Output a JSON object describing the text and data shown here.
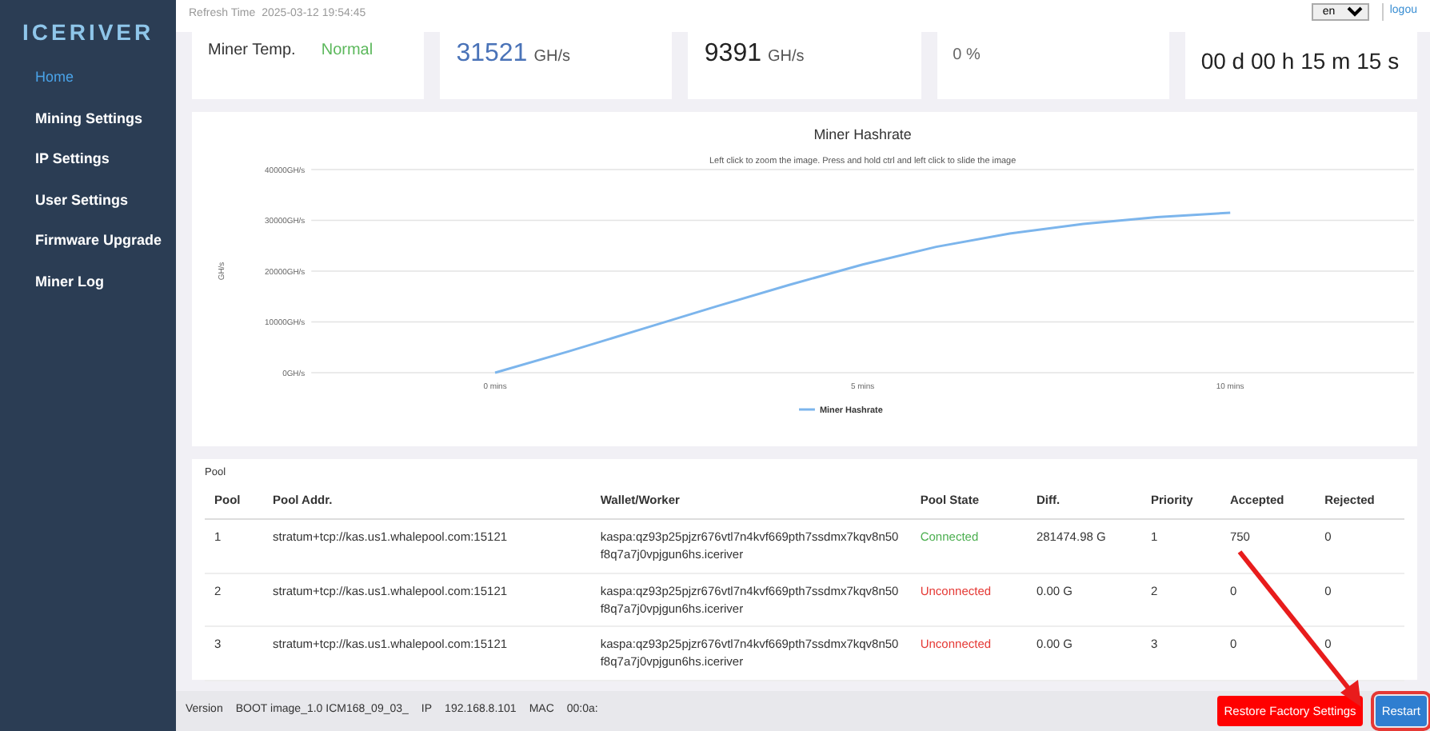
{
  "sidebar": {
    "logo": "ICERIVER",
    "items": [
      {
        "label": "Home",
        "selected": true
      },
      {
        "label": "Mining Settings",
        "selected": false
      },
      {
        "label": "IP Settings",
        "selected": false
      },
      {
        "label": "User Settings",
        "selected": false
      },
      {
        "label": "Firmware Upgrade",
        "selected": false
      },
      {
        "label": "Miner Log",
        "selected": false
      }
    ]
  },
  "header": {
    "refresh_label": "Refresh Time",
    "refresh_time": "2025-03-12 19:54:45",
    "language": "en",
    "logout": "logou"
  },
  "status_cards": [
    {
      "kind": "status",
      "rows": [
        {
          "label": "Miner Temp.",
          "value": "Normal"
        }
      ]
    },
    {
      "kind": "value",
      "value": "31521",
      "unit": "GH/s",
      "accent": true
    },
    {
      "kind": "value",
      "value": "9391",
      "unit": "GH/s",
      "accent": false
    },
    {
      "kind": "small",
      "value": "0 %"
    },
    {
      "kind": "value",
      "value": "00 d 00 h 15 m 15 s",
      "accent": false
    }
  ],
  "chart": {
    "chart_data": {
      "type": "line",
      "title": "Miner Hashrate",
      "subtitle": "Left click to zoom the image. Press and hold ctrl and left click to slide the image",
      "ylabel": "GH/s",
      "x": [
        0,
        1,
        2,
        3,
        4,
        5,
        6,
        7,
        8,
        9,
        10
      ],
      "series": [
        {
          "name": "Miner Hashrate",
          "color": "#7cb5ec",
          "values": [
            0,
            4200,
            8600,
            13000,
            17300,
            21300,
            24800,
            27400,
            29300,
            30600,
            31500
          ]
        }
      ],
      "grid": true,
      "xlim": [
        -2.5,
        12.5
      ],
      "ylim": [
        0,
        40000
      ],
      "xticks": [
        {
          "value": 0,
          "label": "0 mins"
        },
        {
          "value": 5,
          "label": "5 mins"
        },
        {
          "value": 10,
          "label": "10 mins"
        }
      ],
      "yticks": [
        {
          "value": 0,
          "label": "0GH/s"
        },
        {
          "value": 10000,
          "label": "10000GH/s"
        },
        {
          "value": 20000,
          "label": "20000GH/s"
        },
        {
          "value": 30000,
          "label": "30000GH/s"
        },
        {
          "value": 40000,
          "label": "40000GH/s"
        }
      ]
    }
  },
  "pool": {
    "title": "Pool",
    "columns": [
      "Pool",
      "Pool Addr.",
      "Wallet/Worker",
      "Pool State",
      "Diff.",
      "Priority",
      "Accepted",
      "Rejected"
    ],
    "rows": [
      {
        "pool": "1",
        "addr": "stratum+tcp://kas.us1.whalepool.com:15121",
        "wallet": "kaspa:qz93p25pjzr676vtl7n4kvf669pth7ssdmx7kqv8n50f8q7a7j0vpjgun6hs.iceriver",
        "connected": true,
        "state": "Connected",
        "diff": "281474.98 G",
        "priority": "1",
        "accepted": "750",
        "rejected": "0"
      },
      {
        "pool": "2",
        "addr": "stratum+tcp://kas.us1.whalepool.com:15121",
        "wallet": "kaspa:qz93p25pjzr676vtl7n4kvf669pth7ssdmx7kqv8n50f8q7a7j0vpjgun6hs.iceriver",
        "connected": false,
        "state": "Unconnected",
        "diff": "0.00 G",
        "priority": "2",
        "accepted": "0",
        "rejected": "0"
      },
      {
        "pool": "3",
        "addr": "stratum+tcp://kas.us1.whalepool.com:15121",
        "wallet": "kaspa:qz93p25pjzr676vtl7n4kvf669pth7ssdmx7kqv8n50f8q7a7j0vpjgun6hs.iceriver",
        "connected": false,
        "state": "Unconnected",
        "diff": "0.00 G",
        "priority": "3",
        "accepted": "0",
        "rejected": "0"
      }
    ]
  },
  "footer": {
    "fields": [
      {
        "label": "Version",
        "value": "BOOT image_1.0 ICM168_09_03_"
      },
      {
        "label": "IP",
        "value": "192.168.8.101"
      },
      {
        "label": "MAC",
        "value": "00:0a:"
      }
    ],
    "buttons": [
      {
        "label": "Restore Factory Settings",
        "kind": "danger",
        "highlighted": false
      },
      {
        "label": "Restart",
        "kind": "primary",
        "highlighted": true
      }
    ]
  },
  "annotation": {
    "arrow": true
  }
}
